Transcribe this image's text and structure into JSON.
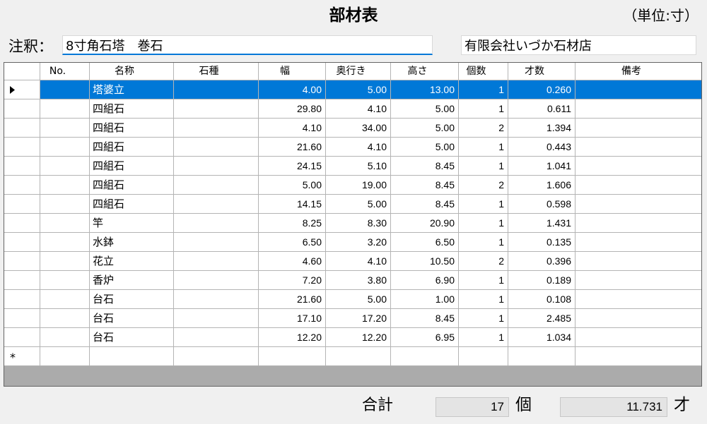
{
  "window": {
    "title": "部材表",
    "unit_label": "（単位:寸）"
  },
  "annotation": {
    "label": "注釈：",
    "value": "8寸角石塔　巻石",
    "company": "有限会社いづか石材店"
  },
  "grid": {
    "columns": [
      "No.",
      "名称",
      "石種",
      "幅",
      "奥行き",
      "高さ",
      "個数",
      "才数",
      "備考"
    ],
    "rows": [
      [
        "",
        "塔婆立",
        "",
        "4.00",
        "5.00",
        "13.00",
        "1",
        "0.260",
        ""
      ],
      [
        "",
        "四組石",
        "",
        "29.80",
        "4.10",
        "5.00",
        "1",
        "0.611",
        ""
      ],
      [
        "",
        "四組石",
        "",
        "4.10",
        "34.00",
        "5.00",
        "2",
        "1.394",
        ""
      ],
      [
        "",
        "四組石",
        "",
        "21.60",
        "4.10",
        "5.00",
        "1",
        "0.443",
        ""
      ],
      [
        "",
        "四組石",
        "",
        "24.15",
        "5.10",
        "8.45",
        "1",
        "1.041",
        ""
      ],
      [
        "",
        "四組石",
        "",
        "5.00",
        "19.00",
        "8.45",
        "2",
        "1.606",
        ""
      ],
      [
        "",
        "四組石",
        "",
        "14.15",
        "5.00",
        "8.45",
        "1",
        "0.598",
        ""
      ],
      [
        "",
        "竿",
        "",
        "8.25",
        "8.30",
        "20.90",
        "1",
        "1.431",
        ""
      ],
      [
        "",
        "水鉢",
        "",
        "6.50",
        "3.20",
        "6.50",
        "1",
        "0.135",
        ""
      ],
      [
        "",
        "花立",
        "",
        "4.60",
        "4.10",
        "10.50",
        "2",
        "0.396",
        ""
      ],
      [
        "",
        "香炉",
        "",
        "7.20",
        "3.80",
        "6.90",
        "1",
        "0.189",
        ""
      ],
      [
        "",
        "台石",
        "",
        "21.60",
        "5.00",
        "1.00",
        "1",
        "0.108",
        ""
      ],
      [
        "",
        "台石",
        "",
        "17.10",
        "17.20",
        "8.45",
        "1",
        "2.485",
        ""
      ],
      [
        "",
        "台石",
        "",
        "12.20",
        "12.20",
        "6.95",
        "1",
        "1.034",
        ""
      ]
    ],
    "selected_row_index": 0,
    "new_row_marker": "*"
  },
  "totals": {
    "label": "合計",
    "count": "17",
    "count_unit": "個",
    "volume": "11.731",
    "volume_unit": "才"
  },
  "icons": {
    "current_row": "current-row-arrow-icon"
  },
  "colors": {
    "selection": "#0078d7",
    "form_background": "#f0f0f0",
    "grid_background": "#ababab",
    "focus_border": "#0078d7"
  }
}
